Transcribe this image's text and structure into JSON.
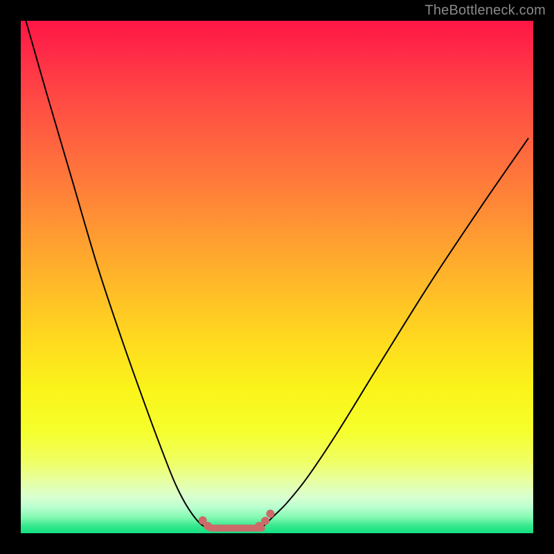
{
  "watermark": "TheBottleneck.com",
  "chart_data": {
    "type": "line",
    "title": "",
    "xlabel": "",
    "ylabel": "",
    "xlim": [
      0,
      100
    ],
    "ylim": [
      0,
      100
    ],
    "legend": false,
    "grid": false,
    "background_gradient": {
      "stops": [
        {
          "pos": 0,
          "color": "#ff1646"
        },
        {
          "pos": 0.5,
          "color": "#ffd91f"
        },
        {
          "pos": 0.86,
          "color": "#f0ff63"
        },
        {
          "pos": 1.0,
          "color": "#12df82"
        }
      ],
      "direction": "top-to-bottom"
    },
    "series": [
      {
        "name": "left-curve",
        "x": [
          1,
          5,
          10,
          15,
          20,
          25,
          28,
          30,
          32,
          34,
          35.5,
          37
        ],
        "values": [
          100,
          86,
          69,
          52,
          37,
          23,
          15,
          10,
          6,
          3,
          1.5,
          1
        ],
        "stroke": "#000000",
        "width": 2
      },
      {
        "name": "right-curve",
        "x": [
          47,
          49,
          52,
          56,
          62,
          70,
          80,
          90,
          99
        ],
        "values": [
          1,
          3,
          6,
          11,
          20,
          33,
          49,
          64,
          77
        ],
        "stroke": "#000000",
        "width": 2
      },
      {
        "name": "flat-bottom",
        "x": [
          37,
          47
        ],
        "values": [
          1,
          1
        ],
        "stroke": "#cc6a6a",
        "width": 10
      }
    ],
    "markers": [
      {
        "x": 35.5,
        "y": 2.5,
        "r": 6,
        "color": "#cc6a6a"
      },
      {
        "x": 36.5,
        "y": 1.4,
        "r": 6,
        "color": "#cc6a6a"
      },
      {
        "x": 46.5,
        "y": 1.4,
        "r": 6,
        "color": "#cc6a6a"
      },
      {
        "x": 47.7,
        "y": 2.4,
        "r": 6,
        "color": "#cc6a6a"
      },
      {
        "x": 48.7,
        "y": 3.8,
        "r": 6,
        "color": "#cc6a6a"
      }
    ]
  }
}
